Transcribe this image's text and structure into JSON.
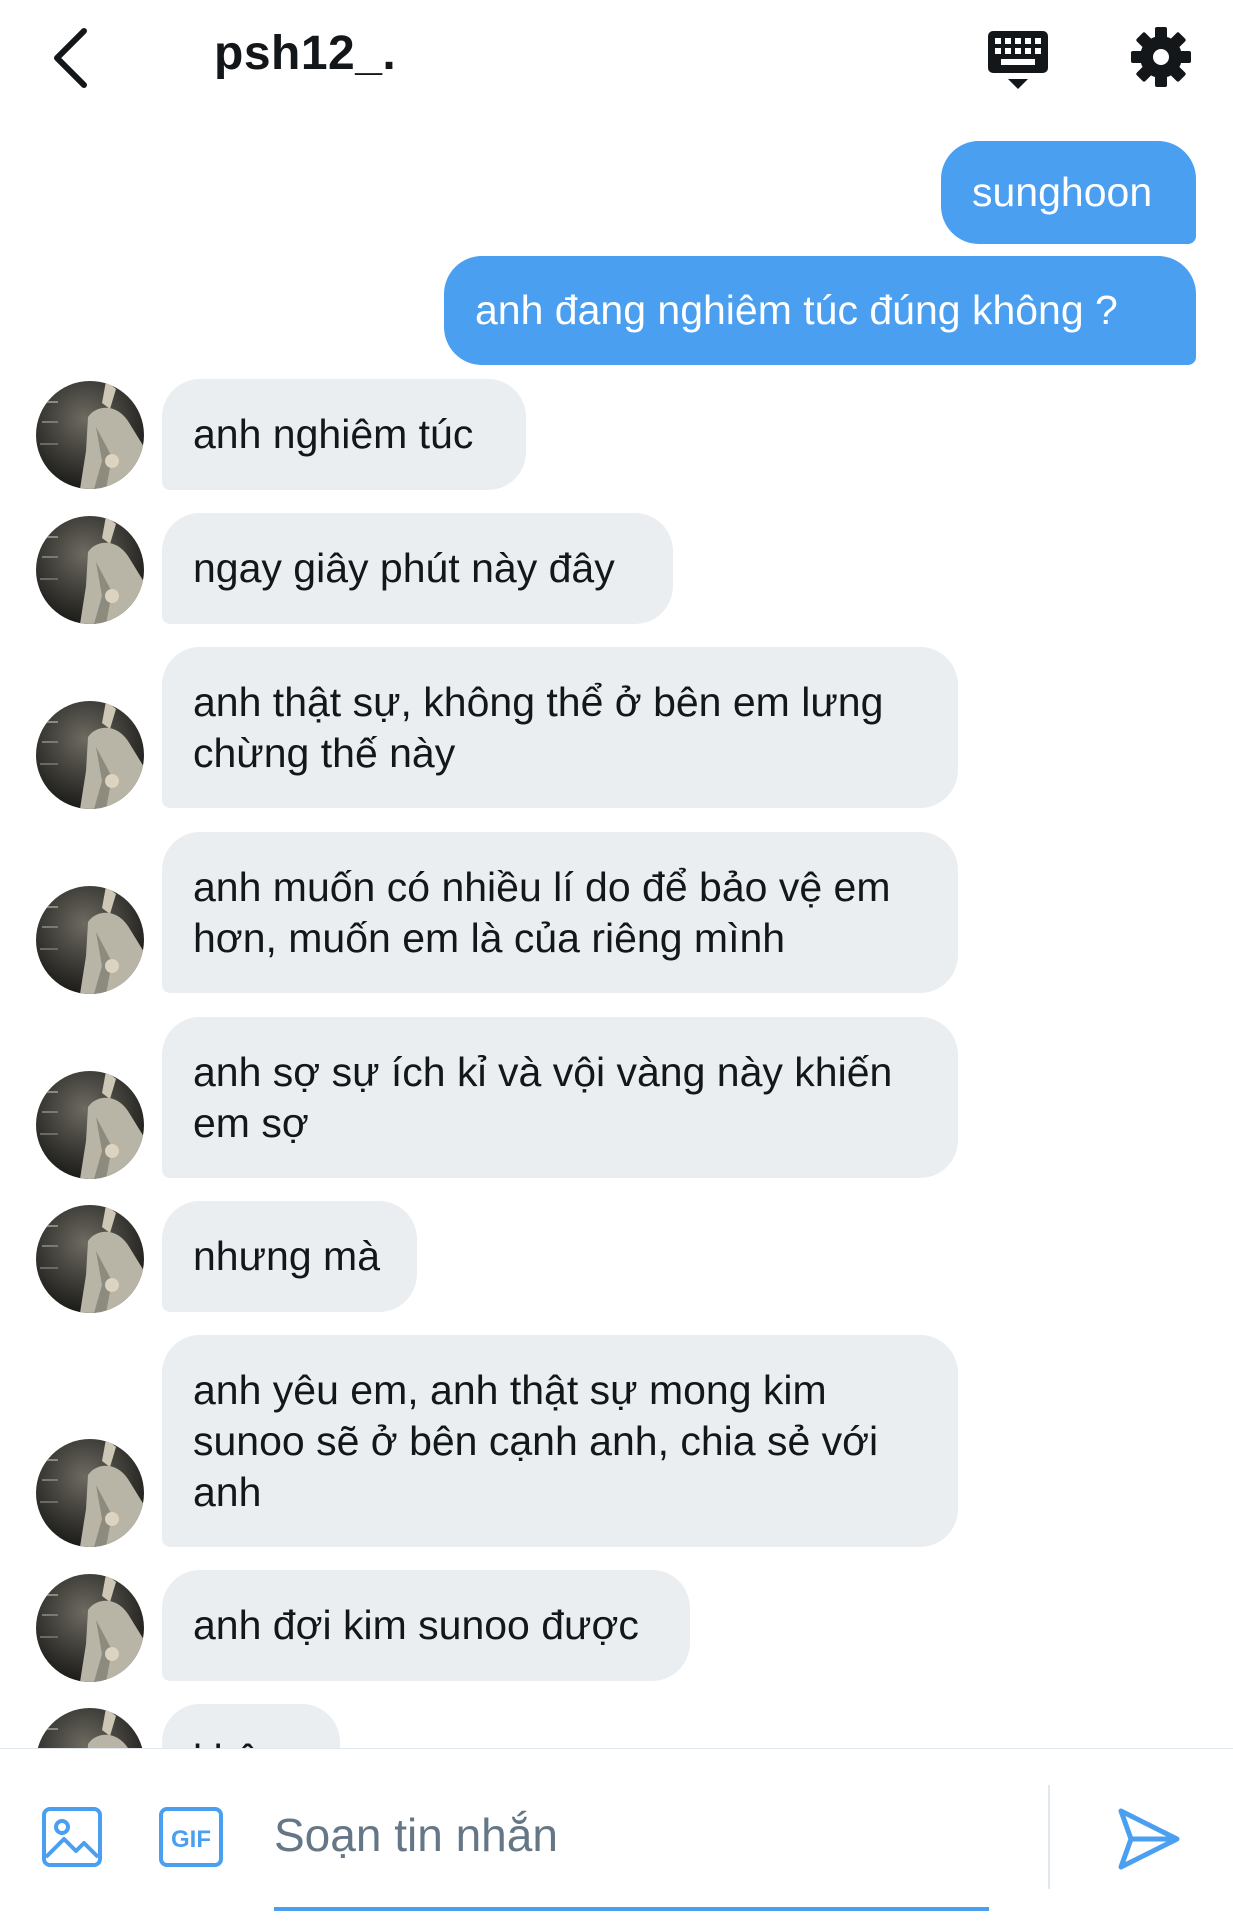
{
  "header": {
    "title": "psh12_."
  },
  "messages": [
    {
      "side": "sent",
      "text": "sunghoon"
    },
    {
      "side": "sent",
      "text": "anh đang nghiêm túc đúng không ?"
    },
    {
      "side": "received",
      "text": "anh nghiêm túc"
    },
    {
      "side": "received",
      "text": "ngay giây phút này đây"
    },
    {
      "side": "received",
      "text": "anh thật sự, không thể ở bên em lưng chừng thế này"
    },
    {
      "side": "received",
      "text": "anh muốn có nhiều lí do để bảo vệ em hơn, muốn em là của riêng mình"
    },
    {
      "side": "received",
      "text": "anh sợ sự ích kỉ và vội vàng này khiến em sợ"
    },
    {
      "side": "received",
      "text": "nhưng mà"
    },
    {
      "side": "received",
      "text": "anh yêu em, anh thật sự mong kim sunoo sẽ ở bên cạnh anh, chia sẻ với anh"
    },
    {
      "side": "received",
      "text": "anh đợi kim sunoo được"
    },
    {
      "side": "received",
      "text": "không"
    }
  ],
  "composer": {
    "placeholder": "Soạn tin nhắn",
    "gif_label": "GIF"
  },
  "colors": {
    "accent": "#4a9ff0",
    "received_bubble": "#ebeef1",
    "text": "#14171a",
    "placeholder": "#657786"
  },
  "icons": {
    "back": "chevron-left-icon",
    "keyboard": "keyboard-icon",
    "settings": "gear-icon",
    "image": "image-icon",
    "gif": "gif-icon",
    "send": "send-icon"
  }
}
